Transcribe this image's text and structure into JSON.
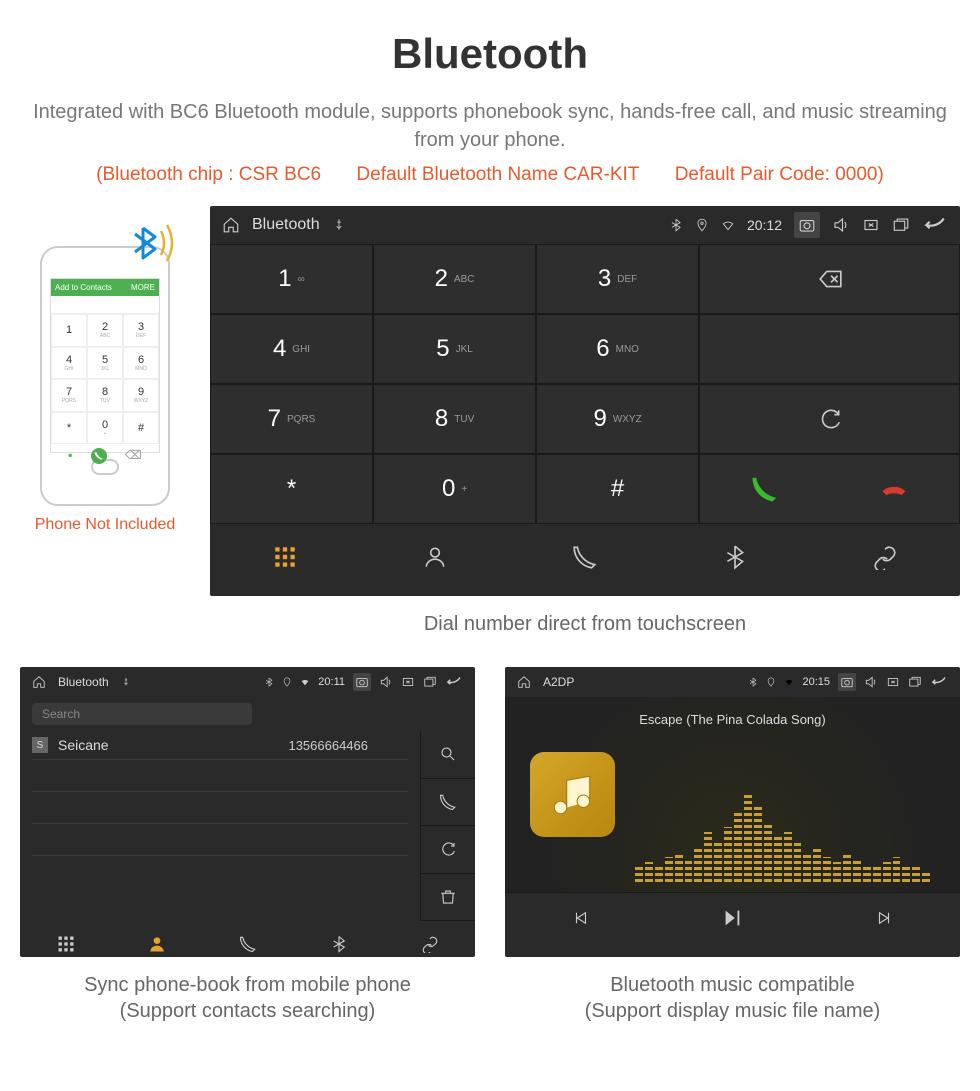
{
  "title": "Bluetooth",
  "description": "Integrated with BC6 Bluetooth module, supports phonebook sync, hands-free call, and music streaming from your phone.",
  "specs": {
    "chip": "(Bluetooth chip : CSR BC6",
    "name": "Default Bluetooth Name CAR-KIT",
    "pair": "Default Pair Code: 0000)"
  },
  "phone_mock": {
    "header_left": "Add to Contacts",
    "header_right": "MORE",
    "keys": [
      {
        "n": "1",
        "l": ""
      },
      {
        "n": "2",
        "l": "ABC"
      },
      {
        "n": "3",
        "l": "DEF"
      },
      {
        "n": "4",
        "l": "GHI"
      },
      {
        "n": "5",
        "l": "JKL"
      },
      {
        "n": "6",
        "l": "MNO"
      },
      {
        "n": "7",
        "l": "PQRS"
      },
      {
        "n": "8",
        "l": "TUV"
      },
      {
        "n": "9",
        "l": "WXYZ"
      },
      {
        "n": "*",
        "l": ""
      },
      {
        "n": "0",
        "l": "+"
      },
      {
        "n": "#",
        "l": ""
      }
    ],
    "caption": "Phone Not Included"
  },
  "dialer": {
    "status_title": "Bluetooth",
    "time": "20:12",
    "keys": [
      {
        "n": "1",
        "l": "∞"
      },
      {
        "n": "2",
        "l": "ABC"
      },
      {
        "n": "3",
        "l": "DEF"
      },
      {
        "n": "4",
        "l": "GHI"
      },
      {
        "n": "5",
        "l": "JKL"
      },
      {
        "n": "6",
        "l": "MNO"
      },
      {
        "n": "7",
        "l": "PQRS"
      },
      {
        "n": "8",
        "l": "TUV"
      },
      {
        "n": "9",
        "l": "WXYZ"
      },
      {
        "n": "*",
        "l": ""
      },
      {
        "n": "0",
        "l": "+"
      },
      {
        "n": "#",
        "l": ""
      }
    ],
    "caption": "Dial number direct from touchscreen"
  },
  "phonebook": {
    "status_title": "Bluetooth",
    "time": "20:11",
    "search_placeholder": "Search",
    "contact_initial": "S",
    "contact_name": "Seicane",
    "contact_number": "13566664466",
    "caption_line1": "Sync phone-book from mobile phone",
    "caption_line2": "(Support contacts searching)"
  },
  "a2dp": {
    "status_title": "A2DP",
    "time": "20:15",
    "track": "Escape (The Pina Colada Song)",
    "caption_line1": "Bluetooth music compatible",
    "caption_line2": "(Support display music file name)"
  }
}
